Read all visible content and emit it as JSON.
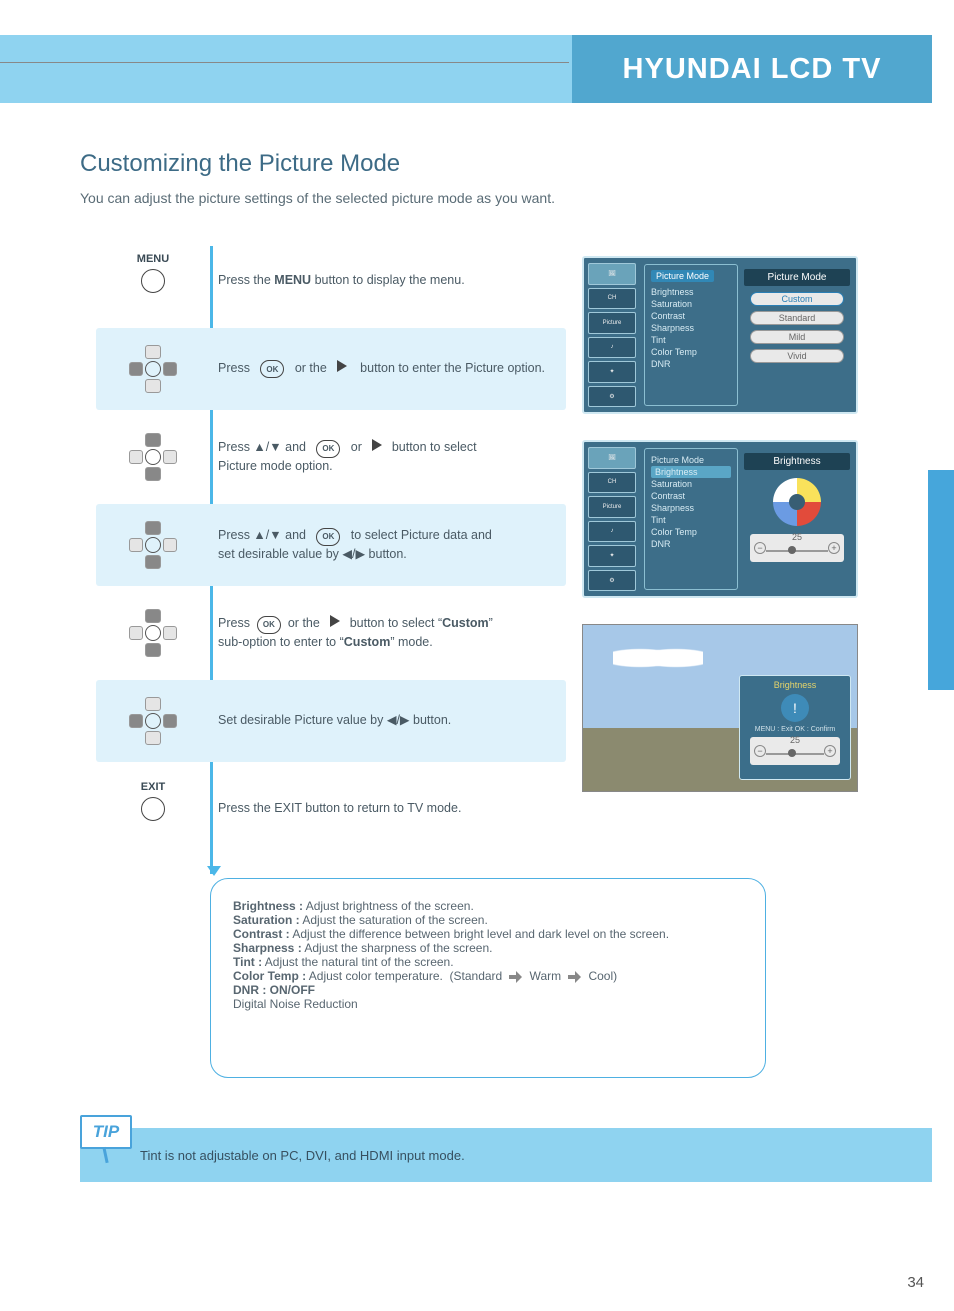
{
  "header": {
    "brand_title": "HYUNDAI LCD TV"
  },
  "section": {
    "title": "Customizing the Picture Mode",
    "subtitle": "You can adjust the picture settings of the selected picture mode as you want."
  },
  "flow": {
    "menu_label": "MENU",
    "exit_label": "EXIT",
    "ok": "OK",
    "steps": [
      {
        "text_parts": [
          "Press the ",
          "MENU",
          " button to display the menu."
        ]
      },
      {
        "text_parts": [
          "Press            or the      button to enter the Picture option."
        ]
      },
      {
        "text_parts": [
          "Press ▲/▼ and          or      button to select Picture mode option."
        ]
      },
      {
        "text_parts": [
          "Press ▲/▼ and           to select Picture data and set desirable value by ◀/▶ button."
        ]
      },
      {
        "text_parts": [
          "Press            or the      button to select \"",
          "Custom",
          " \" sub-option to enter to \"",
          "Custom",
          " \" mode."
        ]
      },
      {
        "text_parts": [
          "Set desirable Picture value by ◀/▶ button."
        ]
      },
      {
        "text_parts": [
          "Press the EXIT button to return to TV mode."
        ]
      }
    ]
  },
  "osd": {
    "left_tabs": [
      "Picture",
      "CH",
      "Picture",
      "Sound",
      "Function",
      "Setup"
    ],
    "menu1": {
      "title": "Picture Mode",
      "items": [
        "Brightness",
        "Saturation",
        "Contrast",
        "Sharpness",
        "Tint",
        "Color Temp",
        "DNR"
      ],
      "right_title": "Picture Mode",
      "options": [
        "Custom",
        "Standard",
        "Mild",
        "Vivid"
      ]
    },
    "menu2": {
      "right_title": "Brightness",
      "highlight": "Brightness",
      "items": [
        "Picture Mode",
        "Brightness",
        "Saturation",
        "Contrast",
        "Sharpness",
        "Tint",
        "Color Temp",
        "DNR"
      ],
      "value": "25"
    },
    "overlay": {
      "title": "Brightness",
      "hint": "MENU : Exit     OK : Confirm",
      "value": "25"
    }
  },
  "desc": {
    "h1": "Brightness :",
    "t1": "Adjust brightness of the screen.",
    "h2": "Saturation :",
    "t2": "Adjust the saturation of the screen.",
    "h3": "Contrast :",
    "t3": "Adjust the difference between bright level and dark level on the screen.",
    "h4": "Sharpness :",
    "t4": "Adjust the sharpness of the screen.",
    "h5": "Tint :",
    "t5": "Adjust the natural tint of the screen.",
    "h6": "Color Temp :",
    "t6": "Adjust color temperature. (Standard       Warm       Cool)",
    "h7": "DNR : ON/OFF",
    "t7": "Digital Noise Reduction"
  },
  "tip": {
    "badge": "TIP",
    "text": "Tint is not adjustable on PC, DVI, and HDMI input mode."
  },
  "page_number": "34"
}
